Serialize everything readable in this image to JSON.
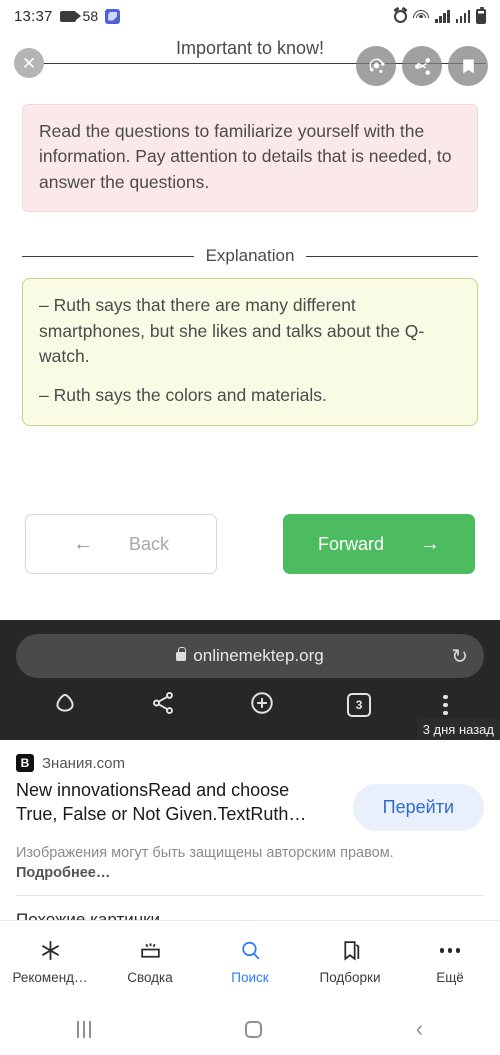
{
  "status_bar": {
    "time": "13:37",
    "notif_count": "58",
    "icons": [
      "video-recording-icon",
      "cleaner-icon",
      "alarm-icon",
      "wifi-icon",
      "signal-icon",
      "signal-icon",
      "battery-icon"
    ]
  },
  "lesson": {
    "close_label": "✕",
    "title": "Important to know!",
    "actions": [
      {
        "name": "lens-icon"
      },
      {
        "name": "share-icon"
      },
      {
        "name": "bookmark-icon"
      }
    ],
    "info_text": "Read the questions to familiarize yourself with the information. Pay attention to details that is needed, to answer the questions.",
    "section_label": "Explanation",
    "explanation_lines": [
      "– Ruth says that there are many different smartphones, but she likes and talks about the Q-watch.",
      "– Ruth says the colors and materials."
    ],
    "back_label": "Back",
    "back_arrow": "←",
    "forward_label": "Forward",
    "forward_arrow": "→",
    "colors": {
      "info_bg": "#fbe9ea",
      "info_border": "#f3d7da",
      "explanation_bg": "#fafbe4",
      "explanation_border": "#cdcf86",
      "forward_bg": "#4dbb5f"
    }
  },
  "browser": {
    "url": "onlinemektep.org",
    "lock_icon": "lock-icon",
    "reload_icon": "↻",
    "tab_count": "3",
    "tools": [
      "home-icon",
      "share-icon",
      "new-tab-icon",
      "tab-switcher-icon",
      "overflow-menu-icon"
    ],
    "time_badge": "3 дня назад"
  },
  "result_card": {
    "favicon_letter": "В",
    "source": "Знания.com",
    "title": "New innovationsRead and choose True, False or Not Given.TextRuth…",
    "goto_label": "Перейти",
    "copyright_text": "Изображения могут быть защищены авторским правом. ",
    "copyright_link": "Подробнее…",
    "similar_heading": "Похожие картинки",
    "goto_colors": {
      "bg": "#e9f0fb",
      "text": "#2f6ad0"
    }
  },
  "app_nav": {
    "active_color": "#2b7cf6",
    "items": [
      {
        "label": "Рекоменд…",
        "icon": "asterisk-icon",
        "active": false
      },
      {
        "label": "Сводка",
        "icon": "summary-tray-icon",
        "active": false
      },
      {
        "label": "Поиск",
        "icon": "search-icon",
        "active": true
      },
      {
        "label": "Подборки",
        "icon": "collections-bookmark-icon",
        "active": false
      },
      {
        "label": "Ещё",
        "icon": "more-dots-icon",
        "active": false
      }
    ]
  },
  "system_nav": {
    "recents": "recents-icon",
    "home": "home-icon",
    "back": "‹"
  }
}
